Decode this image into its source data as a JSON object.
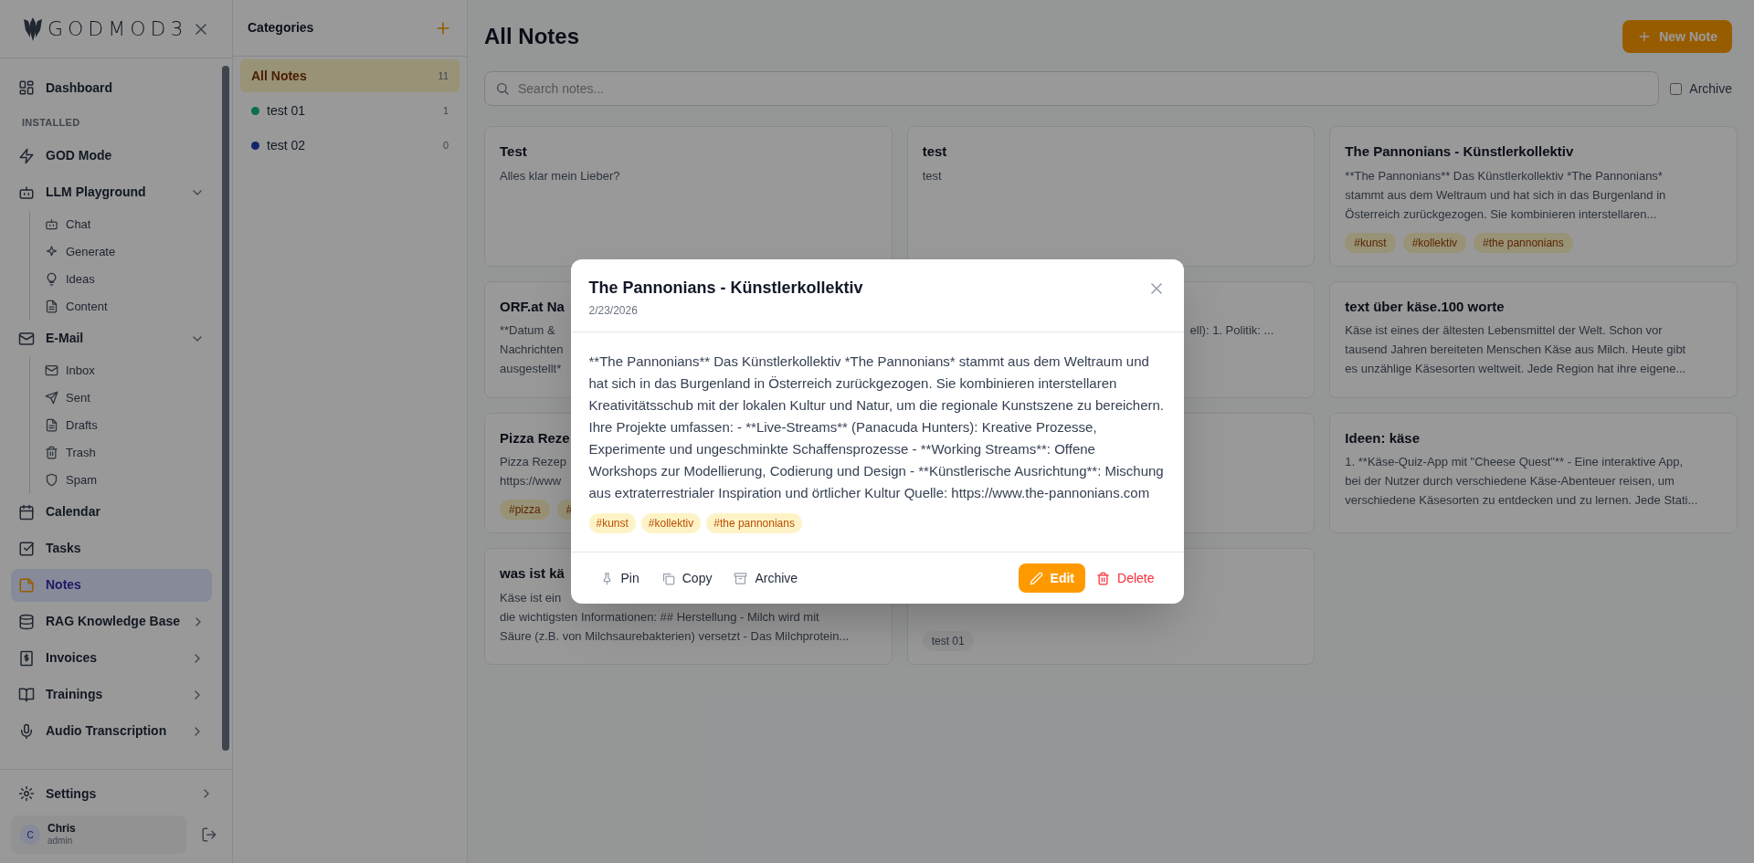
{
  "sidebar": {
    "logo": "GODMOD3",
    "items": [
      {
        "kind": "link",
        "label": "Dashboard",
        "selected": false
      },
      {
        "kind": "section",
        "label": "INSTALLED"
      },
      {
        "kind": "link",
        "label": "GOD Mode",
        "selected": false
      },
      {
        "kind": "group",
        "label": "LLM Playground",
        "expanded": true,
        "selected": false,
        "children": [
          {
            "label": "Chat"
          },
          {
            "label": "Generate"
          },
          {
            "label": "Ideas"
          },
          {
            "label": "Content"
          }
        ]
      },
      {
        "kind": "group",
        "label": "E-Mail",
        "expanded": true,
        "selected": false,
        "children": [
          {
            "label": "Inbox"
          },
          {
            "label": "Sent"
          },
          {
            "label": "Drafts"
          },
          {
            "label": "Trash"
          },
          {
            "label": "Spam"
          }
        ]
      },
      {
        "kind": "link",
        "label": "Calendar",
        "selected": false
      },
      {
        "kind": "link",
        "label": "Tasks",
        "selected": false
      },
      {
        "kind": "link",
        "label": "Notes",
        "selected": true
      },
      {
        "kind": "group",
        "label": "RAG Knowledge Base",
        "expanded": false,
        "selected": false
      },
      {
        "kind": "group",
        "label": "Invoices",
        "expanded": false,
        "selected": false
      },
      {
        "kind": "group",
        "label": "Trainings",
        "expanded": false,
        "selected": false
      },
      {
        "kind": "group",
        "label": "Audio Transcription",
        "expanded": false,
        "selected": false
      }
    ],
    "settings": "Settings",
    "user": {
      "initial": "C",
      "name": "Chris",
      "role": "admin"
    }
  },
  "categories": {
    "title": "Categories",
    "items": [
      {
        "label": "All Notes",
        "count": "11",
        "selected": true
      },
      {
        "label": "test 01",
        "count": "1",
        "selected": false,
        "color": "#0a6f4d"
      },
      {
        "label": "test 02",
        "count": "0",
        "selected": false,
        "color": "#122669"
      }
    ]
  },
  "main": {
    "title": "All Notes",
    "new_button": "New Note",
    "search": {
      "placeholder": "Search notes..."
    },
    "archive": {
      "label": "Archive",
      "checked": false
    },
    "notes": [
      {
        "title": "Test",
        "lines": [
          "Alles klar mein Lieber?"
        ]
      },
      {
        "title": "test",
        "lines": [
          "test"
        ]
      },
      {
        "title": "The Pannonians - Künstlerkollektiv",
        "lines": [
          "**The Pannonians** Das Künstlerkollektiv *The Pannonians*",
          "stammt aus dem Weltraum und hat sich in das Burgenland in",
          "Österreich zurückgezogen. Sie kombinieren interstellaren..."
        ],
        "tags": [
          {
            "kind": "tag",
            "label": "#kunst"
          },
          {
            "kind": "tag",
            "label": "#kollektiv"
          },
          {
            "kind": "tag",
            "label": "#the pannonians"
          }
        ]
      },
      {
        "title": "ORF.at Na",
        "lines": [
          "**Datum &",
          "Nachrichten",
          "ausgestellt*"
        ]
      },
      {
        "tail": "ell): 1. Politik: ..."
      },
      {
        "title": "text über käse.100 worte",
        "lines": [
          "Käse ist eines der ältesten Lebensmittel der Welt. Schon vor",
          "tausend Jahren bereiteten Menschen Käse aus Milch. Heute gibt",
          "es unzählige Käsesorten weltweit. Jede Region hat ihre eigene..."
        ]
      },
      {
        "title": "Pizza Reze",
        "lines": [
          "Pizza Rezep",
          "https://www"
        ],
        "tags": [
          {
            "kind": "tag",
            "label": "#pizza"
          },
          {
            "kind": "tag",
            "label": "#"
          }
        ]
      },
      {
        "kind": "covered"
      },
      {
        "title": "Ideen: käse",
        "lines": [
          "1. **Käse-Quiz-App mit \"Cheese Quest\"** - Eine interaktive App,",
          "bei der Nutzer durch verschiedene Käse-Abenteuer reisen, um",
          "verschiedene Käsesorten zu entdecken und zu lernen. Jede Stati..."
        ]
      },
      {
        "title": "was ist kä",
        "lines": [
          "Käse ist ein",
          "die wichtigsten Informationen: ## Herstellung - Milch wird mit",
          "Säure (z.B. von Milchsaurebakterien) versetzt - Das Milchprotein..."
        ]
      },
      {
        "tags": [
          {
            "kind": "category",
            "label": "test 01"
          }
        ]
      }
    ]
  },
  "modal": {
    "title": "The Pannonians - Künstlerkollektiv",
    "date": "2/23/2026",
    "body": "**The Pannonians** Das Künstlerkollektiv *The Pannonians* stammt aus dem Weltraum und hat sich in das Burgenland in Österreich zurückgezogen. Sie kombinieren interstellaren Kreativitätsschub mit der lokalen Kultur und Natur, um die regionale Kunstszene zu bereichern. Ihre Projekte umfassen: - **Live-Streams** (Panacuda Hunters): Kreative Prozesse, Experimente und ungeschminkte Schaffensprozesse - **Working Streams**: Offene Workshops zur Modellierung, Codierung und Design - **Künstlerische Ausrichtung**: Mischung aus extraterrestrialer Inspiration und örtlicher Kultur Quelle: https://www.the-pannonians.com",
    "tags": [
      "#kunst",
      "#kollektiv",
      "#the pannonians"
    ],
    "actions": [
      {
        "kind": "plain",
        "label": "Pin"
      },
      {
        "kind": "plain",
        "label": "Copy"
      },
      {
        "kind": "plain",
        "label": "Archive"
      },
      {
        "kind": "primary",
        "label": "Edit"
      },
      {
        "kind": "danger",
        "label": "Delete"
      }
    ]
  }
}
